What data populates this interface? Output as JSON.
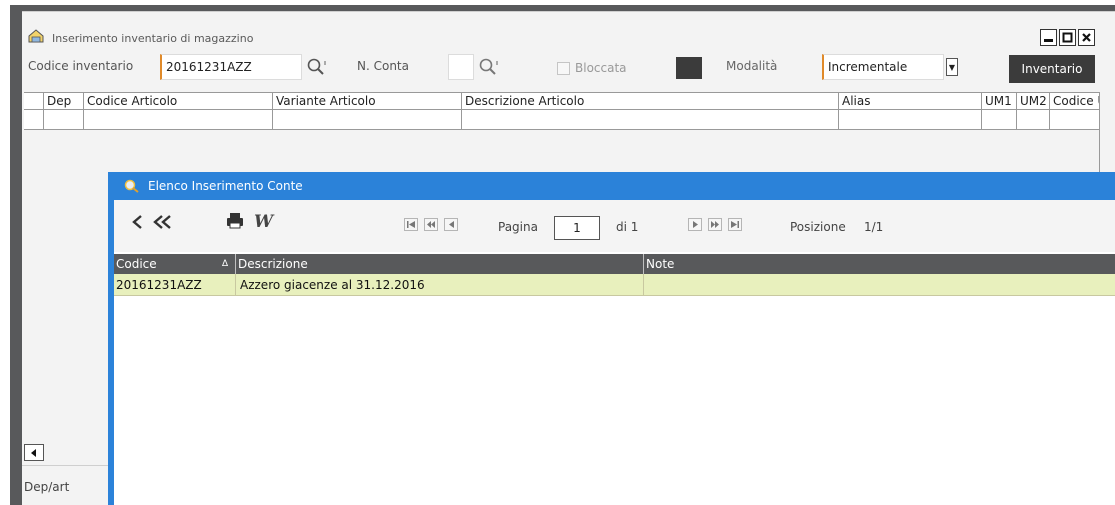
{
  "main_window": {
    "title": "Inserimento inventario di magazzino",
    "toolbar": {
      "codice_label": "Codice inventario",
      "codice_value": "20161231AZZ",
      "nconta_label": "N. Conta",
      "nconta_value": "",
      "bloccata_label": "Bloccata",
      "modalita_label": "Modalità",
      "modalita_value": "Incrementale",
      "inventario_button": "Inventario"
    },
    "grid": {
      "columns": [
        "Dep",
        "Codice Articolo",
        "Variante Articolo",
        "Descrizione Articolo",
        "Alias",
        "UM1",
        "UM2",
        "Codice U"
      ]
    },
    "footer_label": "Dep/art"
  },
  "popup": {
    "title": "Elenco Inserimento Conte",
    "pagination": {
      "page_label": "Pagina",
      "page_value": "1",
      "of_label": "di 1",
      "position_label": "Posizione",
      "position_value": "1/1"
    },
    "grid": {
      "columns": [
        "Codice",
        "Descrizione",
        "Note"
      ],
      "sort_indicator": "∆",
      "rows": [
        {
          "codice": "20161231AZZ",
          "descrizione": "Azzero giacenze al 31.12.2016",
          "note": ""
        }
      ]
    }
  },
  "colors": {
    "accent": "#2b82d9",
    "frame": "#58595b",
    "row_highlight": "#e8f0bd",
    "required_field": "#e08a2a"
  },
  "icons": [
    "home-folder-icon",
    "search-icon",
    "minimize-icon",
    "maximize-icon",
    "close-icon",
    "back-icon",
    "first-back-icon",
    "print-icon",
    "word-icon",
    "first-page-icon",
    "prev-fast-icon",
    "prev-page-icon",
    "next-page-icon",
    "next-fast-icon",
    "last-page-icon"
  ]
}
